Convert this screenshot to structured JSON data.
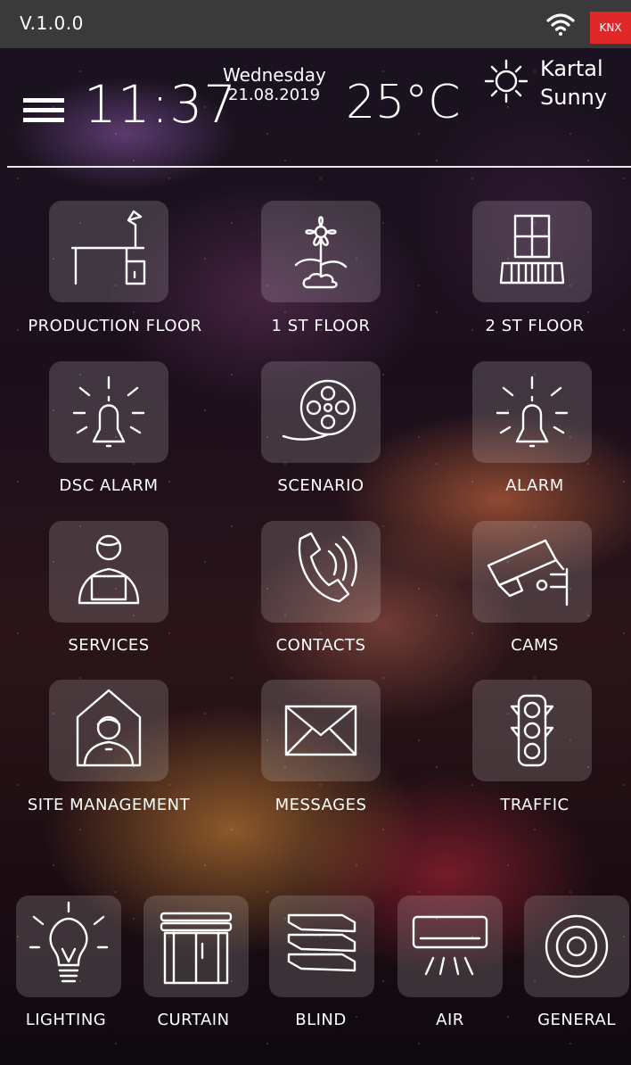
{
  "header": {
    "version": "V.1.0.0",
    "knx_badge": "KNX",
    "time": "11:37",
    "day": "Wednesday",
    "date": "21.08.2019",
    "temperature": "25°C",
    "city": "Kartal",
    "condition": "Sunny"
  },
  "grid": [
    {
      "label": "PRODUCTION FLOOR",
      "icon": "desk-lamp-icon"
    },
    {
      "label": "1 ST FLOOR",
      "icon": "flower-pot-icon"
    },
    {
      "label": "2 ST FLOOR",
      "icon": "window-balcony-icon"
    },
    {
      "label": "DSC ALARM",
      "icon": "alarm-bell-icon"
    },
    {
      "label": "SCENARIO",
      "icon": "film-reel-icon"
    },
    {
      "label": "ALARM",
      "icon": "alarm-bell-icon"
    },
    {
      "label": "SERVICES",
      "icon": "person-laptop-icon"
    },
    {
      "label": "CONTACTS",
      "icon": "phone-ringing-icon"
    },
    {
      "label": "CAMS",
      "icon": "security-camera-icon"
    },
    {
      "label": "SITE MANAGEMENT",
      "icon": "house-person-icon"
    },
    {
      "label": "MESSAGES",
      "icon": "envelope-icon"
    },
    {
      "label": "TRAFFIC",
      "icon": "traffic-light-icon"
    }
  ],
  "bottom": [
    {
      "label": "LIGHTING",
      "icon": "lightbulb-icon"
    },
    {
      "label": "CURTAIN",
      "icon": "curtain-icon"
    },
    {
      "label": "BLIND",
      "icon": "blind-icon"
    },
    {
      "label": "AIR",
      "icon": "air-conditioner-icon"
    },
    {
      "label": "GENERAL",
      "icon": "target-icon"
    }
  ],
  "colors": {
    "topbar": "#3a3a3a",
    "knx": "#e02828",
    "tile": "rgba(255,255,255,0.16)"
  }
}
